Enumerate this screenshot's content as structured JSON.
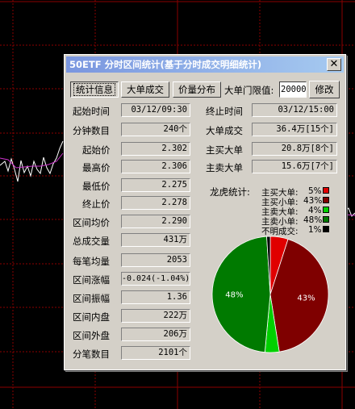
{
  "window": {
    "title": "50ETF 分时区间统计(基于分时成交明细统计)",
    "close": "✕"
  },
  "tabs": [
    {
      "label": "统计信息",
      "active": true
    },
    {
      "label": "大单成交",
      "active": false
    },
    {
      "label": "价量分布",
      "active": false
    }
  ],
  "threshold": {
    "label": "大单门限值:",
    "value": "20000",
    "button": "修改"
  },
  "left_stats": [
    {
      "label": "起始时间",
      "value": "03/12/09:30"
    },
    {
      "label": "分钟数目",
      "value": "240个"
    },
    {
      "label": "起始价",
      "value": "2.302"
    },
    {
      "label": "最高价",
      "value": "2.306"
    },
    {
      "label": "最低价",
      "value": "2.275"
    },
    {
      "label": "终止价",
      "value": "2.278"
    },
    {
      "label": "区间均价",
      "value": "2.290"
    },
    {
      "label": "总成交量",
      "value": "431万"
    },
    {
      "label": "每笔均量",
      "value": "2053"
    },
    {
      "label": "区间涨幅",
      "value": "-0.024(-1.04%)"
    },
    {
      "label": "区间振幅",
      "value": "1.36"
    },
    {
      "label": "区间内盘",
      "value": "222万"
    },
    {
      "label": "区间外盘",
      "value": "206万"
    },
    {
      "label": "分笔数目",
      "value": "2101个"
    }
  ],
  "right_stats": [
    {
      "label": "终止时间",
      "value": "03/12/15:00"
    },
    {
      "label": "大单成交",
      "value": "36.4万[15个]"
    },
    {
      "label": "主买大单",
      "value": "20.8万[8个]"
    },
    {
      "label": "主卖大单",
      "value": "15.6万[7个]"
    }
  ],
  "dragon_tiger": {
    "title": "龙虎统计:",
    "legend": [
      {
        "label": "主买大单:",
        "percent": "5%",
        "color": "#E00000"
      },
      {
        "label": "主买小单:",
        "percent": "43%",
        "color": "#7F0000"
      },
      {
        "label": "主卖大单:",
        "percent": "4%",
        "color": "#00D000"
      },
      {
        "label": "主卖小单:",
        "percent": "48%",
        "color": "#007A00"
      },
      {
        "label": "不明成交:",
        "percent": "1%",
        "color": "#000000"
      }
    ]
  },
  "chart_data": {
    "type": "pie",
    "categories": [
      "主买大单",
      "主买小单",
      "主卖大单",
      "主卖小单",
      "不明成交"
    ],
    "values": [
      5,
      43,
      4,
      48,
      1
    ],
    "colors": [
      "#E00000",
      "#7F0000",
      "#00D000",
      "#007A00",
      "#000000"
    ],
    "slice_labels": [
      "",
      "43%",
      "",
      "48%",
      ""
    ]
  }
}
